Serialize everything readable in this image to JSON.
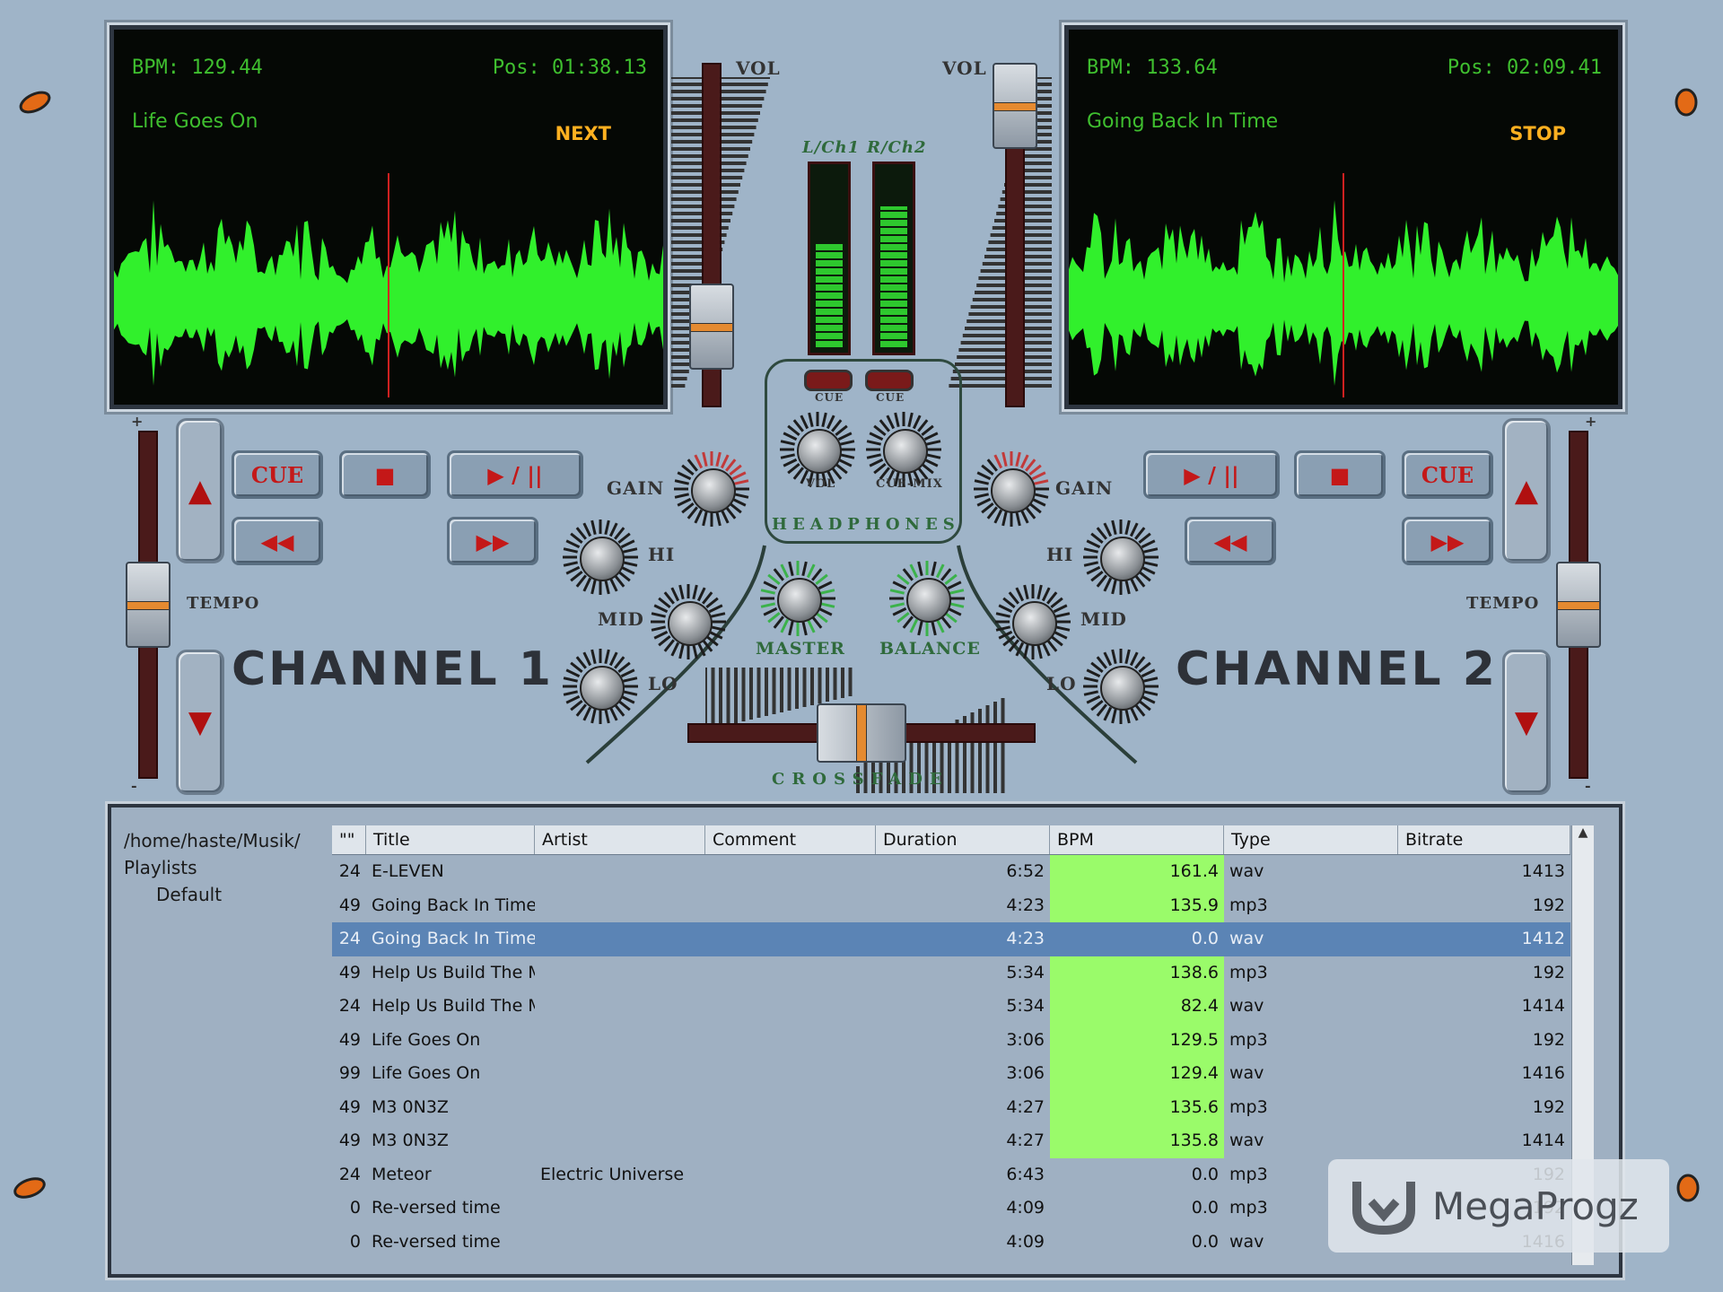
{
  "deck1": {
    "bpm": "BPM: 129.44",
    "pos": "Pos: 01:38.13",
    "track": "Life Goes On",
    "state": "NEXT"
  },
  "deck2": {
    "bpm": "BPM: 133.64",
    "pos": "Pos: 02:09.41",
    "track": "Going Back In Time",
    "state": "STOP"
  },
  "mixer": {
    "vol_left": "VOL",
    "vol_right": "VOL",
    "vu_left": "L/Ch1",
    "vu_right": "R/Ch2",
    "cue_left": "CUE",
    "cue_right": "CUE",
    "hp_vol": "VOL",
    "hp_cuemix": "CUE-MIX",
    "headphones": "HEADPHONES",
    "master": "MASTER",
    "balance": "BALANCE",
    "crossfade": "CROSSFADE",
    "vu_levels": [
      0.55,
      0.75
    ]
  },
  "channel1": {
    "title": "CHANNEL 1",
    "cue": "CUE",
    "gain": "GAIN",
    "hi": "HI",
    "mid": "MID",
    "lo": "LO",
    "tempo": "TEMPO",
    "plus": "+",
    "minus": "-"
  },
  "channel2": {
    "title": "CHANNEL 2",
    "cue": "CUE",
    "gain": "GAIN",
    "hi": "HI",
    "mid": "MID",
    "lo": "LO",
    "tempo": "TEMPO",
    "plus": "+",
    "minus": "-"
  },
  "icons": {
    "play": "play-pause-icon",
    "stop": "stop-icon",
    "rew": "rewind-icon",
    "ff": "fast-forward-icon"
  },
  "browser": {
    "tree": [
      "/home/haste/Musik/",
      "Playlists",
      "Default"
    ],
    "columns": [
      "\"\"",
      "Title",
      "Artist",
      "Comment",
      "Duration",
      "BPM",
      "Type",
      "Bitrate"
    ],
    "rows": [
      {
        "n": "24",
        "title": "E-LEVEN",
        "artist": "",
        "comment": "",
        "duration": "6:52",
        "bpm": "161.4",
        "type": "wav",
        "bitrate": "1413",
        "hl": true
      },
      {
        "n": "49",
        "title": "Going Back In Time",
        "artist": "",
        "comment": "",
        "duration": "4:23",
        "bpm": "135.9",
        "type": "mp3",
        "bitrate": "192",
        "hl": true
      },
      {
        "n": "24",
        "title": "Going Back In Time",
        "artist": "",
        "comment": "",
        "duration": "4:23",
        "bpm": "0.0",
        "type": "wav",
        "bitrate": "1412",
        "hl": false,
        "sel": true
      },
      {
        "n": "49",
        "title": "Help Us Build The Mi",
        "artist": "",
        "comment": "",
        "duration": "5:34",
        "bpm": "138.6",
        "type": "mp3",
        "bitrate": "192",
        "hl": true
      },
      {
        "n": "24",
        "title": "Help Us Build The Mi",
        "artist": "",
        "comment": "",
        "duration": "5:34",
        "bpm": "82.4",
        "type": "wav",
        "bitrate": "1414",
        "hl": true
      },
      {
        "n": "49",
        "title": "Life Goes On",
        "artist": "",
        "comment": "",
        "duration": "3:06",
        "bpm": "129.5",
        "type": "mp3",
        "bitrate": "192",
        "hl": true
      },
      {
        "n": "99",
        "title": "Life Goes On",
        "artist": "",
        "comment": "",
        "duration": "3:06",
        "bpm": "129.4",
        "type": "wav",
        "bitrate": "1416",
        "hl": true
      },
      {
        "n": "49",
        "title": "M3 0N3Z",
        "artist": "",
        "comment": "",
        "duration": "4:27",
        "bpm": "135.6",
        "type": "mp3",
        "bitrate": "192",
        "hl": true
      },
      {
        "n": "49",
        "title": "M3 0N3Z",
        "artist": "",
        "comment": "",
        "duration": "4:27",
        "bpm": "135.8",
        "type": "wav",
        "bitrate": "1414",
        "hl": true
      },
      {
        "n": "24",
        "title": "Meteor",
        "artist": "Electric Universe",
        "comment": "",
        "duration": "6:43",
        "bpm": "0.0",
        "type": "mp3",
        "bitrate": "192",
        "hl": false
      },
      {
        "n": "0",
        "title": "Re-versed time",
        "artist": "",
        "comment": "",
        "duration": "4:09",
        "bpm": "0.0",
        "type": "mp3",
        "bitrate": "192",
        "hl": false
      },
      {
        "n": "0",
        "title": "Re-versed time",
        "artist": "",
        "comment": "",
        "duration": "4:09",
        "bpm": "0.0",
        "type": "wav",
        "bitrate": "1416",
        "hl": false
      }
    ]
  },
  "watermark": "MegaProgz"
}
